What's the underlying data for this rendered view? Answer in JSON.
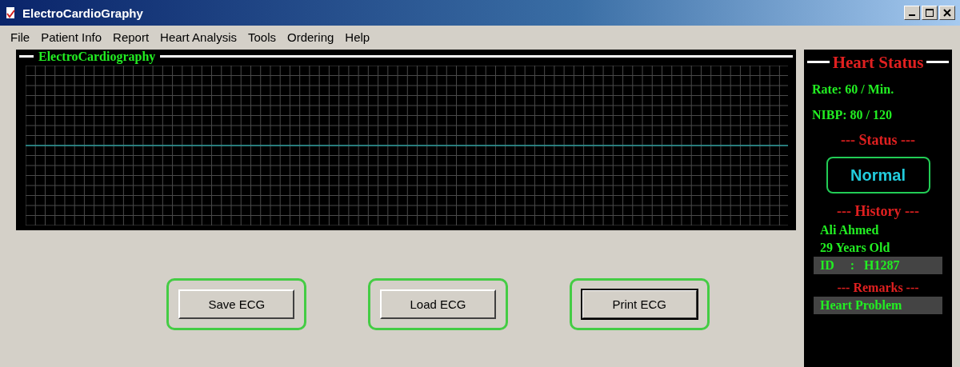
{
  "window": {
    "title": "ElectroCardioGraphy"
  },
  "menu": [
    {
      "label": "File"
    },
    {
      "label": "Patient Info"
    },
    {
      "label": "Report"
    },
    {
      "label": "Heart Analysis"
    },
    {
      "label": "Tools"
    },
    {
      "label": "Ordering"
    },
    {
      "label": "Help"
    }
  ],
  "ecg_panel": {
    "title": "ElectroCardiography"
  },
  "buttons": [
    {
      "label": "Save ECG",
      "default": false
    },
    {
      "label": "Load ECG",
      "default": false
    },
    {
      "label": "Print ECG",
      "default": true
    }
  ],
  "heart_status": {
    "title": "Heart Status",
    "rate": "Rate:  60 / Min.",
    "nibp": "NIBP:  80 / 120",
    "status_heading": "--- Status ---",
    "status": "Normal",
    "history_heading": "--- History ---",
    "name": "Ali Ahmed",
    "age": "29 Years Old",
    "id": "ID     :   H1287",
    "remarks_heading": "--- Remarks ---",
    "remarks": "Heart Problem"
  }
}
